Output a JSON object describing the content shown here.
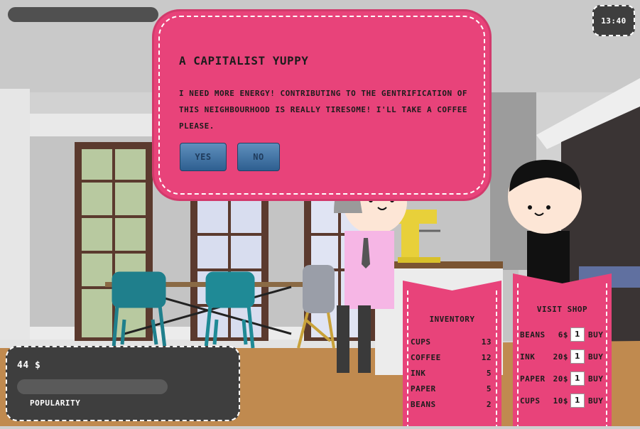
{
  "hud": {
    "clock": "13:40",
    "money": "44 $",
    "popularity_label": "POPULARITY"
  },
  "dialog": {
    "title": "A CAPITALIST YUPPY",
    "message": "I NEED MORE ENERGY! CONTRIBUTING TO THE GENTRIFICATION OF THIS NEIGHBOURHOOD IS REALLY TIRESOME! I'LL TAKE A COFFEE PLEASE.",
    "yes_label": "YES",
    "no_label": "NO"
  },
  "inventory": {
    "title": "INVENTORY",
    "items": [
      {
        "name": "CUPS",
        "count": "13"
      },
      {
        "name": "COFFEE",
        "count": "12"
      },
      {
        "name": "INK",
        "count": "5"
      },
      {
        "name": "PAPER",
        "count": "5"
      },
      {
        "name": "BEANS",
        "count": "2"
      }
    ]
  },
  "shop": {
    "title": "VISIT SHOP",
    "items": [
      {
        "name": "BEANS",
        "price": "6$",
        "qty": "1",
        "buy": "BUY"
      },
      {
        "name": "INK",
        "price": "20$",
        "qty": "1",
        "buy": "BUY"
      },
      {
        "name": "PAPER",
        "price": "20$",
        "qty": "1",
        "buy": "BUY"
      },
      {
        "name": "CUPS",
        "price": "10$",
        "qty": "1",
        "buy": "BUY"
      }
    ]
  },
  "colors": {
    "accent_pink": "#e8437a",
    "hud_dark": "#3e3e3e",
    "button_blue": "#3f72a6"
  }
}
